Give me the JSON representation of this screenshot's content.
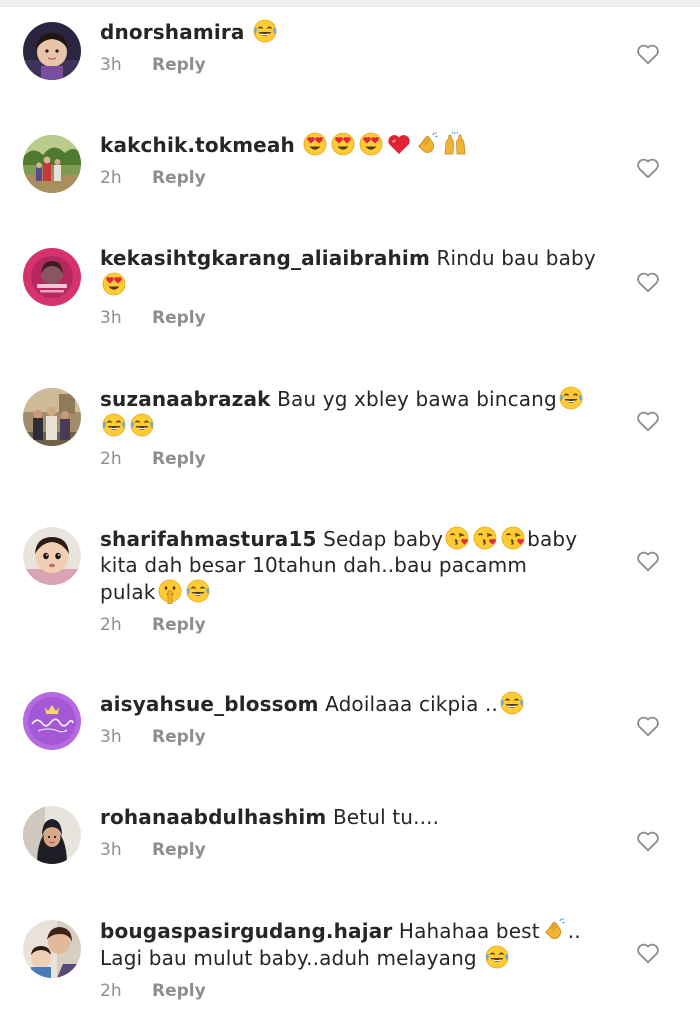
{
  "icons": {
    "like": "heart-outline-icon"
  },
  "labels": {
    "reply": "Reply"
  },
  "comments": [
    {
      "username": "dnorshamira",
      "segments": [
        {
          "emoji": "joy"
        }
      ],
      "time": "3h",
      "avatar": "avatar-child-photo"
    },
    {
      "username": "kakchik.tokmeah",
      "segments": [
        {
          "emoji": "heart-eyes"
        },
        {
          "emoji": "heart-eyes"
        },
        {
          "emoji": "heart-eyes"
        },
        {
          "emoji": "red-heart"
        },
        {
          "emoji": "clapping-hands"
        },
        {
          "emoji": "raising-hands"
        }
      ],
      "time": "2h",
      "avatar": "avatar-outdoor-photo"
    },
    {
      "username": "kekasihtgkarang_aliaibrahim",
      "segments": [
        {
          "text": "Rindu bau baby"
        },
        {
          "break": true
        },
        {
          "emoji": "heart-eyes"
        }
      ],
      "time": "3h",
      "avatar": "avatar-pink-logo"
    },
    {
      "username": "suzanaabrazak",
      "segments": [
        {
          "text": "Bau yg xbley bawa bincang"
        },
        {
          "emoji": "joy"
        },
        {
          "break": true
        },
        {
          "emoji": "joy"
        },
        {
          "emoji": "joy"
        }
      ],
      "time": "2h",
      "avatar": "avatar-group-photo"
    },
    {
      "username": "sharifahmastura15",
      "segments": [
        {
          "text": "Sedap baby"
        },
        {
          "emoji": "kiss"
        },
        {
          "emoji": "kiss"
        },
        {
          "emoji": "kiss"
        },
        {
          "text": "baby"
        },
        {
          "break": true
        },
        {
          "text": "kita dah besar 10tahun dah..bau pacamm"
        },
        {
          "break": true
        },
        {
          "text": "pulak"
        },
        {
          "emoji": "shush"
        },
        {
          "emoji": "joy"
        }
      ],
      "time": "2h",
      "avatar": "avatar-baby-photo"
    },
    {
      "username": "aisyahsue_blossom",
      "segments": [
        {
          "text": "Adoilaaa cikpia .."
        },
        {
          "emoji": "joy"
        }
      ],
      "time": "3h",
      "avatar": "avatar-purple-logo"
    },
    {
      "username": "rohanaabdulhashim",
      "segments": [
        {
          "text": "Betul tu...."
        }
      ],
      "time": "3h",
      "avatar": "avatar-woman-photo"
    },
    {
      "username": "bougaspasirgudang.hajar",
      "segments": [
        {
          "text": "Hahahaa best"
        },
        {
          "emoji": "clapping-hands"
        },
        {
          "text": ".."
        },
        {
          "break": true
        },
        {
          "text": "Lagi bau mulut baby..aduh melayang "
        },
        {
          "emoji": "joy"
        }
      ],
      "time": "2h",
      "avatar": "avatar-family-photo"
    }
  ]
}
